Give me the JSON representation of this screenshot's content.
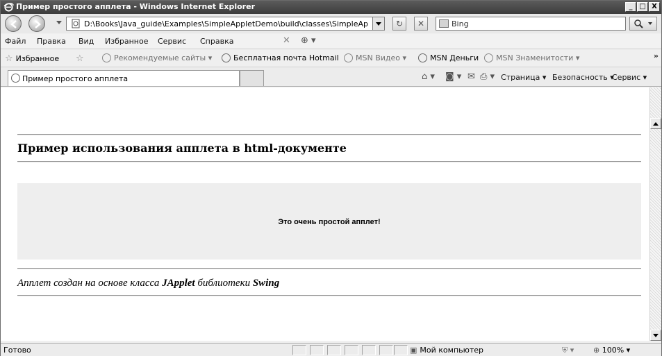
{
  "window": {
    "title": "Пример простого апплета - Windows Internet Explorer",
    "controls": {
      "minimize": "_",
      "maximize": "□",
      "close": "X"
    }
  },
  "address_bar": {
    "url": "D:\\Books\\Java_guide\\Examples\\SimpleAppletDemo\\build\\classes\\SimpleApplet",
    "search_placeholder": "Bing"
  },
  "menu": {
    "items": [
      "Файл",
      "Правка",
      "Вид",
      "Избранное",
      "Сервис",
      "Справка"
    ]
  },
  "favorites": {
    "label": "Избранное",
    "items": [
      "Рекомендуемые сайты ▾",
      "Бесплатная почта Hotmail",
      "MSN Видео ▾",
      "MSN Деньги",
      "MSN Знаменитости ▾"
    ]
  },
  "tab": {
    "label": "Пример простого апплета"
  },
  "command_bar": {
    "page": "Страница ▾",
    "safety": "Безопасность ▾",
    "tools": "Сервис ▾"
  },
  "content": {
    "heading": "Пример использования апплета в html-документе",
    "applet_message": "Это очень простой апплет!",
    "note_prefix": "Апплет создан на основе класса ",
    "note_class": "JApplet",
    "note_middle": " библиотеки ",
    "note_lib": "Swing"
  },
  "status_bar": {
    "text": "Готово",
    "zone": "Мой компьютер",
    "zoom": "100%"
  }
}
